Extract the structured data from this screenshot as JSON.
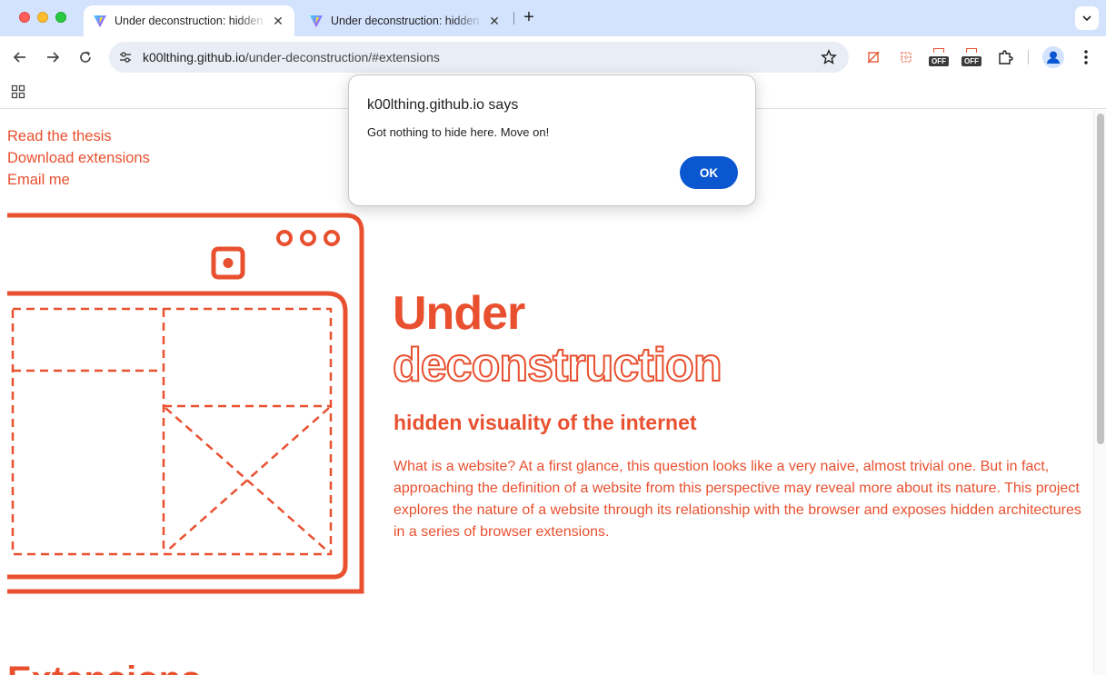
{
  "browser": {
    "tabs": [
      {
        "title": "Under deconstruction: hidden visuality of the internet",
        "active": true
      },
      {
        "title": "Under deconstruction: hidden visuality of the internet",
        "active": false
      }
    ],
    "new_tab_label": "+",
    "close_glyph": "✕",
    "url_host": "k00lthing.github.io",
    "url_path": "/under-deconstruction/#extensions",
    "extension_badges": [
      "OFF",
      "OFF"
    ],
    "icons": [
      "back-icon",
      "forward-icon",
      "reload-icon",
      "site-settings-icon",
      "bookmark-star-icon",
      "extensions-puzzle-icon",
      "profile-icon",
      "menu-kebab-icon",
      "apps-grid-icon",
      "tab-search-chevron-icon"
    ]
  },
  "page": {
    "nav": [
      "Read the thesis",
      "Download extensions",
      "Email me"
    ],
    "hero_line1": "Under",
    "hero_line2": "deconstruction",
    "subtitle": "hidden visuality of the internet",
    "description": "What is a website? At a first glance, this question looks like a very naive, almost trivial one. But in fact, approaching the definition of a website from this perspective may reveal more about its nature. This project explores the nature of a website through its relationship with the browser and exposes hidden architectures in a series of browser extensions.",
    "extensions_heading": "Extensions",
    "accent_color": "#e8502f"
  },
  "dialog": {
    "title": "k00lthing.github.io says",
    "message": "Got nothing to hide here. Move on!",
    "ok_label": "OK",
    "button_color": "#0b57d0"
  }
}
